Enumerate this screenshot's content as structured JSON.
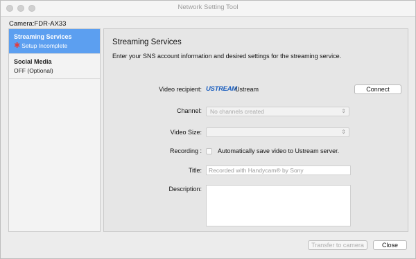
{
  "window": {
    "title": "Network Setting Tool"
  },
  "camera": {
    "label": "Camera:FDR-AX33"
  },
  "sidebar": {
    "items": [
      {
        "name": "Streaming Services",
        "status": "Setup Incomplete"
      },
      {
        "name": "Social Media",
        "status": "OFF (Optional)"
      }
    ]
  },
  "panel": {
    "title": "Streaming Services",
    "description": "Enter your SNS account information and desired settings for the streaming service.",
    "video_recipient": {
      "label": "Video recipient:",
      "logo": "USTREAM",
      "name": "Ustream",
      "connect_label": "Connect"
    },
    "channel": {
      "label": "Channel:",
      "value": "No channels created"
    },
    "video_size": {
      "label": "Video Size:",
      "value": ""
    },
    "recording": {
      "label": "Recording :",
      "checkbox_label": "Automatically save video to Ustream server.",
      "checked": false
    },
    "title_field": {
      "label": "Title:",
      "value": "Recorded with Handycam® by Sony"
    },
    "description_field": {
      "label": "Description:",
      "value": ""
    }
  },
  "footer": {
    "transfer_label": "Transfer to camera",
    "close_label": "Close"
  }
}
